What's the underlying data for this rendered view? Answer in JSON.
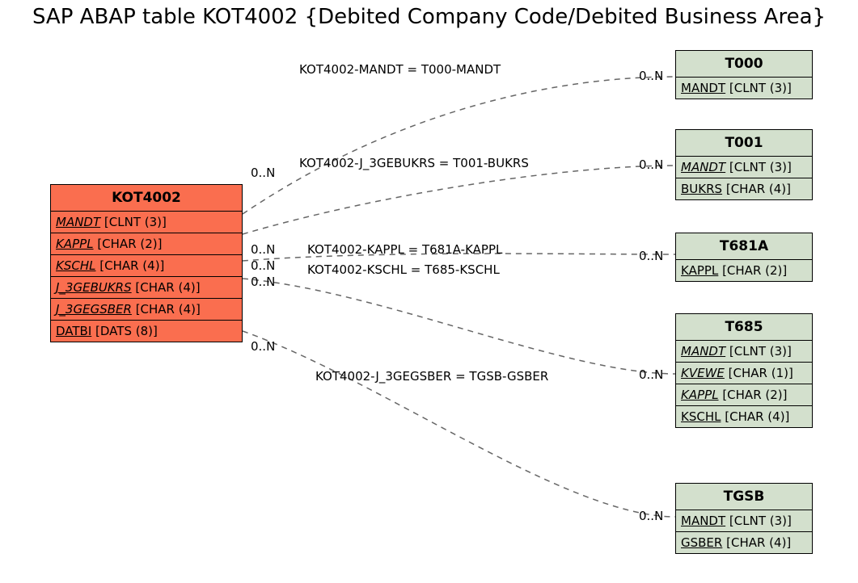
{
  "title": "SAP ABAP table KOT4002 {Debited Company Code/Debited Business Area}",
  "main": {
    "name": "KOT4002",
    "fields": [
      {
        "name": "MANDT",
        "type": "[CLNT (3)]",
        "italic": true
      },
      {
        "name": "KAPPL",
        "type": "[CHAR (2)]",
        "italic": true
      },
      {
        "name": "KSCHL",
        "type": "[CHAR (4)]",
        "italic": true
      },
      {
        "name": "J_3GEBUKRS",
        "type": "[CHAR (4)]",
        "italic": true
      },
      {
        "name": "J_3GEGSBER",
        "type": "[CHAR (4)]",
        "italic": true
      },
      {
        "name": "DATBI",
        "type": "[DATS (8)]",
        "italic": false
      }
    ]
  },
  "refs": [
    {
      "name": "T000",
      "fields": [
        {
          "name": "MANDT",
          "type": "[CLNT (3)]",
          "italic": false
        }
      ]
    },
    {
      "name": "T001",
      "fields": [
        {
          "name": "MANDT",
          "type": "[CLNT (3)]",
          "italic": true
        },
        {
          "name": "BUKRS",
          "type": "[CHAR (4)]",
          "italic": false
        }
      ]
    },
    {
      "name": "T681A",
      "fields": [
        {
          "name": "KAPPL",
          "type": "[CHAR (2)]",
          "italic": false
        }
      ]
    },
    {
      "name": "T685",
      "fields": [
        {
          "name": "MANDT",
          "type": "[CLNT (3)]",
          "italic": true
        },
        {
          "name": "KVEWE",
          "type": "[CHAR (1)]",
          "italic": true
        },
        {
          "name": "KAPPL",
          "type": "[CHAR (2)]",
          "italic": true
        },
        {
          "name": "KSCHL",
          "type": "[CHAR (4)]",
          "italic": false
        }
      ]
    },
    {
      "name": "TGSB",
      "fields": [
        {
          "name": "MANDT",
          "type": "[CLNT (3)]",
          "italic": false
        },
        {
          "name": "GSBER",
          "type": "[CHAR (4)]",
          "italic": false
        }
      ]
    }
  ],
  "edges": [
    {
      "label": "KOT4002-MANDT = T000-MANDT",
      "left_card": "0..N",
      "right_card": "0..N"
    },
    {
      "label": "KOT4002-J_3GEBUKRS = T001-BUKRS",
      "left_card": "0..N",
      "right_card": "0..N"
    },
    {
      "label": "KOT4002-KAPPL = T681A-KAPPL",
      "left_card": "0..N",
      "right_card": "0..N"
    },
    {
      "label": "KOT4002-KSCHL = T685-KSCHL",
      "left_card": "0..N",
      "right_card": "0..N"
    },
    {
      "label": "KOT4002-J_3GEGSBER = TGSB-GSBER",
      "left_card": "0..N",
      "right_card": "0..N"
    }
  ]
}
